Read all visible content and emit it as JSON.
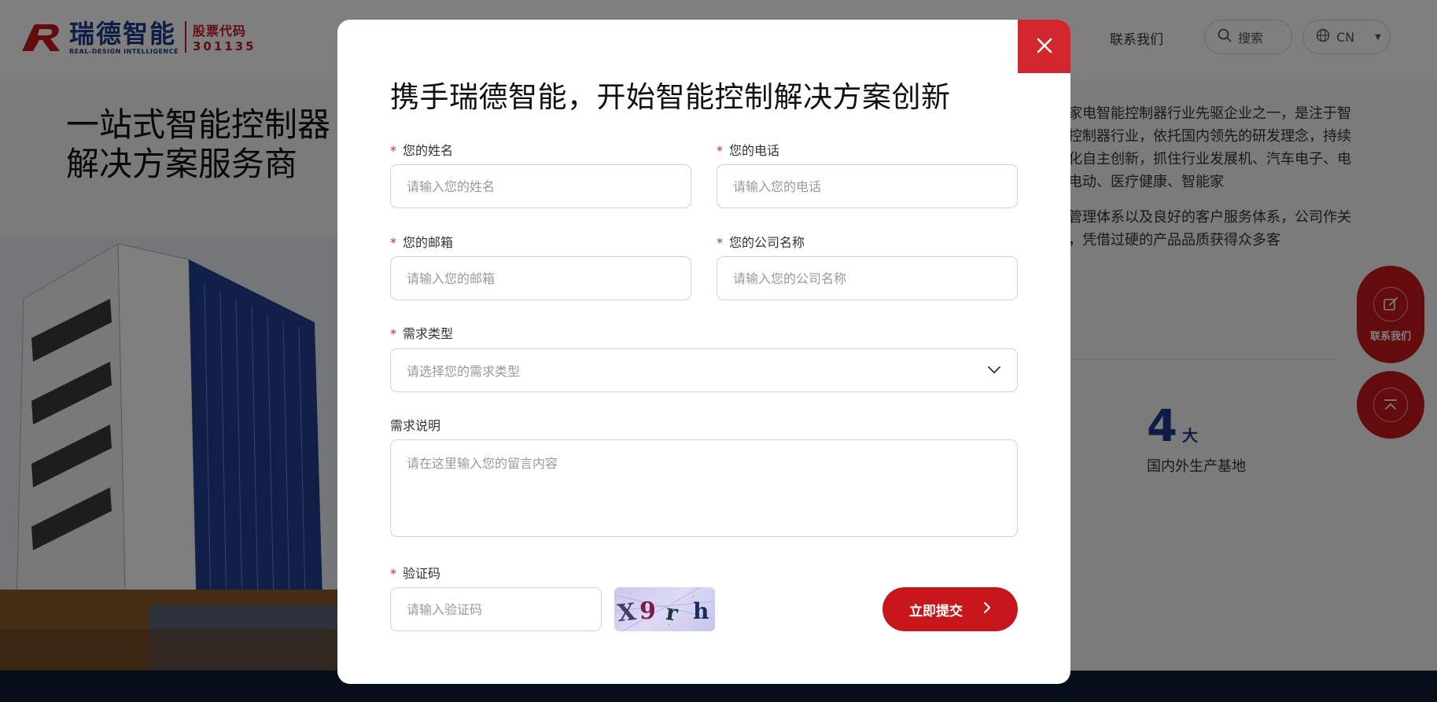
{
  "header": {
    "logo": {
      "name_cn": "瑞德智能",
      "name_en": "REAL-DESIGN INTELLIGENCE",
      "stock_label": "股票代码",
      "stock_code": "301135"
    },
    "nav_contact": "联系我们",
    "search_label": "搜索",
    "language": "CN"
  },
  "hero": {
    "title_line1": "一站式智能控制器",
    "title_line2": "解决方案服务商"
  },
  "about": {
    "para1": "为家电智能控制器行业先驱企业之一，是注于智能控制器行业，依托国内领先的研发理念，持续强化自主创新，抓住行业发展机、汽车电子、电机电动、医疗健康、智能家",
    "para2": "量管理体系以及良好的客户服务体系，公司作关系，凭借过硬的产品品质获得众多客"
  },
  "stat": {
    "number": "4",
    "unit": "大",
    "label": "国内外生产基地"
  },
  "float_buttons": {
    "contact_label": "联系我们"
  },
  "modal": {
    "title": "携手瑞德智能，开始智能控制解决方案创新",
    "required_mark": "*",
    "fields": {
      "name": {
        "label": "您的姓名",
        "placeholder": "请输入您的姓名"
      },
      "phone": {
        "label": "您的电话",
        "placeholder": "请输入您的电话"
      },
      "email": {
        "label": "您的邮箱",
        "placeholder": "请输入您的邮箱"
      },
      "company": {
        "label": "您的公司名称",
        "placeholder": "请输入您的公司名称"
      },
      "demand_type": {
        "label": "需求类型",
        "placeholder": "请选择您的需求类型"
      },
      "demand_desc": {
        "label": "需求说明",
        "placeholder": "请在这里输入您的留言内容"
      },
      "captcha": {
        "label": "验证码",
        "placeholder": "请输入验证码",
        "image_text": "X9rh"
      }
    },
    "submit_label": "立即提交"
  },
  "colors": {
    "brand_red": "#c8161d",
    "brand_blue": "#1b3a8a",
    "close_red": "#d1272d"
  }
}
